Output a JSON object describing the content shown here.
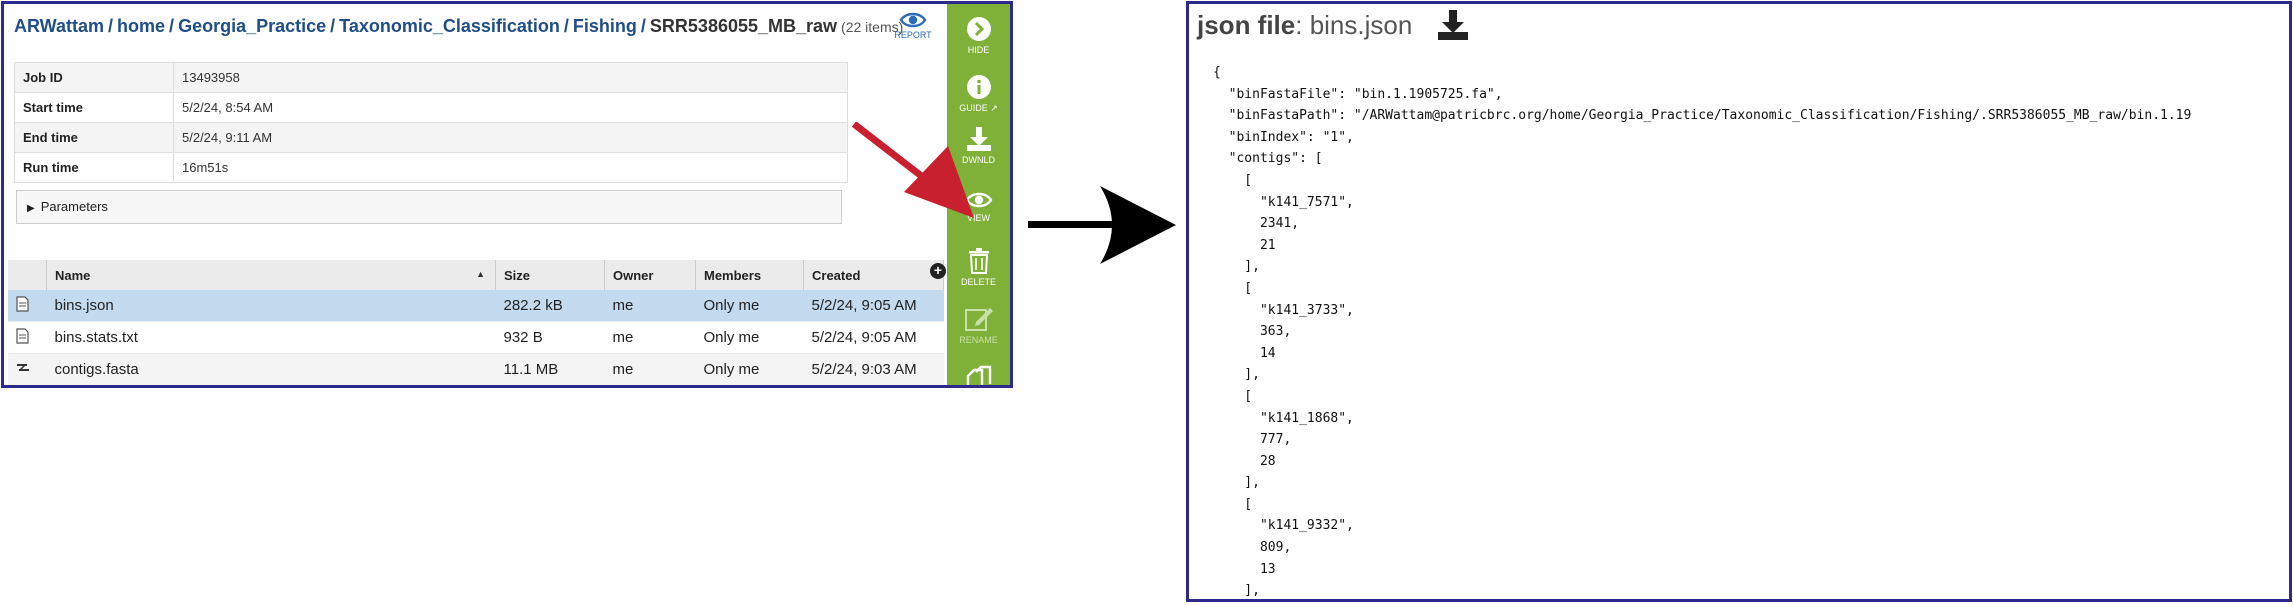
{
  "breadcrumb": {
    "parts": [
      "ARWattam",
      "home",
      "Georgia_Practice",
      "Taxonomic_Classification",
      "Fishing"
    ],
    "current": "SRR5386055_MB_raw",
    "count": "(22 items)"
  },
  "report_label": "REPORT",
  "job_info": [
    {
      "key": "Job ID",
      "value": "13493958"
    },
    {
      "key": "Start time",
      "value": "5/2/24, 8:54 AM"
    },
    {
      "key": "End time",
      "value": "5/2/24, 9:11 AM"
    },
    {
      "key": "Run time",
      "value": "16m51s"
    }
  ],
  "parameters_label": "Parameters",
  "file_table": {
    "headers": [
      "Name",
      "Size",
      "Owner",
      "Members",
      "Created"
    ],
    "rows": [
      {
        "name": "bins.json",
        "size": "282.2 kB",
        "owner": "me",
        "members": "Only me",
        "created": "5/2/24, 9:05 AM"
      },
      {
        "name": "bins.stats.txt",
        "size": "932 B",
        "owner": "me",
        "members": "Only me",
        "created": "5/2/24, 9:05 AM"
      },
      {
        "name": "contigs.fasta",
        "size": "11.1 MB",
        "owner": "me",
        "members": "Only me",
        "created": "5/2/24, 9:03 AM"
      }
    ]
  },
  "actions": {
    "hide": "HIDE",
    "guide": "GUIDE",
    "download": "DWNLD",
    "view": "VIEW",
    "delete": "DELETE",
    "rename": "RENAME"
  },
  "json_viewer": {
    "title_bold": "json file",
    "title_rest": ": bins.json",
    "lines": [
      "{",
      "  \"binFastaFile\": \"bin.1.1905725.fa\",",
      "  \"binFastaPath\": \"/ARWattam@patricbrc.org/home/Georgia_Practice/Taxonomic_Classification/Fishing/.SRR5386055_MB_raw/bin.1.19",
      "  \"binIndex\": \"1\",",
      "  \"contigs\": [",
      "    [",
      "      \"k141_7571\",",
      "      2341,",
      "      21",
      "    ],",
      "    [",
      "      \"k141_3733\",",
      "      363,",
      "      14",
      "    ],",
      "    [",
      "      \"k141_1868\",",
      "      777,",
      "      28",
      "    ],",
      "    [",
      "      \"k141_9332\",",
      "      809,",
      "      13",
      "    ],"
    ]
  },
  "colors": {
    "panel_border": "#2e2a8c",
    "action_bar": "#7fb038",
    "selected_row": "#c4dbef",
    "breadcrumb": "#1f4e8a",
    "red_arrow": "#c8202f"
  }
}
